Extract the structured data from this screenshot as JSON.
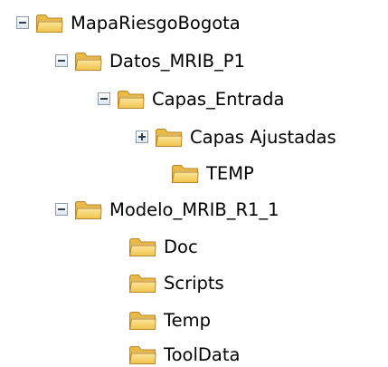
{
  "tree": {
    "root": {
      "label": "MapaRiesgoBogota",
      "toggle": "collapse",
      "icon": "folder-icon"
    },
    "datos": {
      "label": "Datos_MRIB_P1",
      "toggle": "collapse",
      "icon": "folder-icon"
    },
    "capas_entrada": {
      "label": "Capas_Entrada",
      "toggle": "collapse",
      "icon": "folder-icon"
    },
    "capas_ajustadas": {
      "label": "Capas Ajustadas",
      "toggle": "expand",
      "icon": "folder-icon"
    },
    "temp_upper": {
      "label": "TEMP",
      "icon": "folder-icon"
    },
    "modelo": {
      "label": "Modelo_MRIB_R1_1",
      "toggle": "collapse",
      "icon": "folder-icon"
    },
    "doc": {
      "label": "Doc",
      "icon": "folder-icon"
    },
    "scripts": {
      "label": "Scripts",
      "icon": "folder-icon"
    },
    "temp": {
      "label": "Temp",
      "icon": "folder-icon"
    },
    "tooldata": {
      "label": "ToolData",
      "icon": "folder-icon"
    }
  },
  "colors": {
    "folder_front": "#f6d46a",
    "folder_back": "#e7b63e",
    "folder_outline": "#b8862a",
    "toggle_border": "#8c9cae"
  }
}
